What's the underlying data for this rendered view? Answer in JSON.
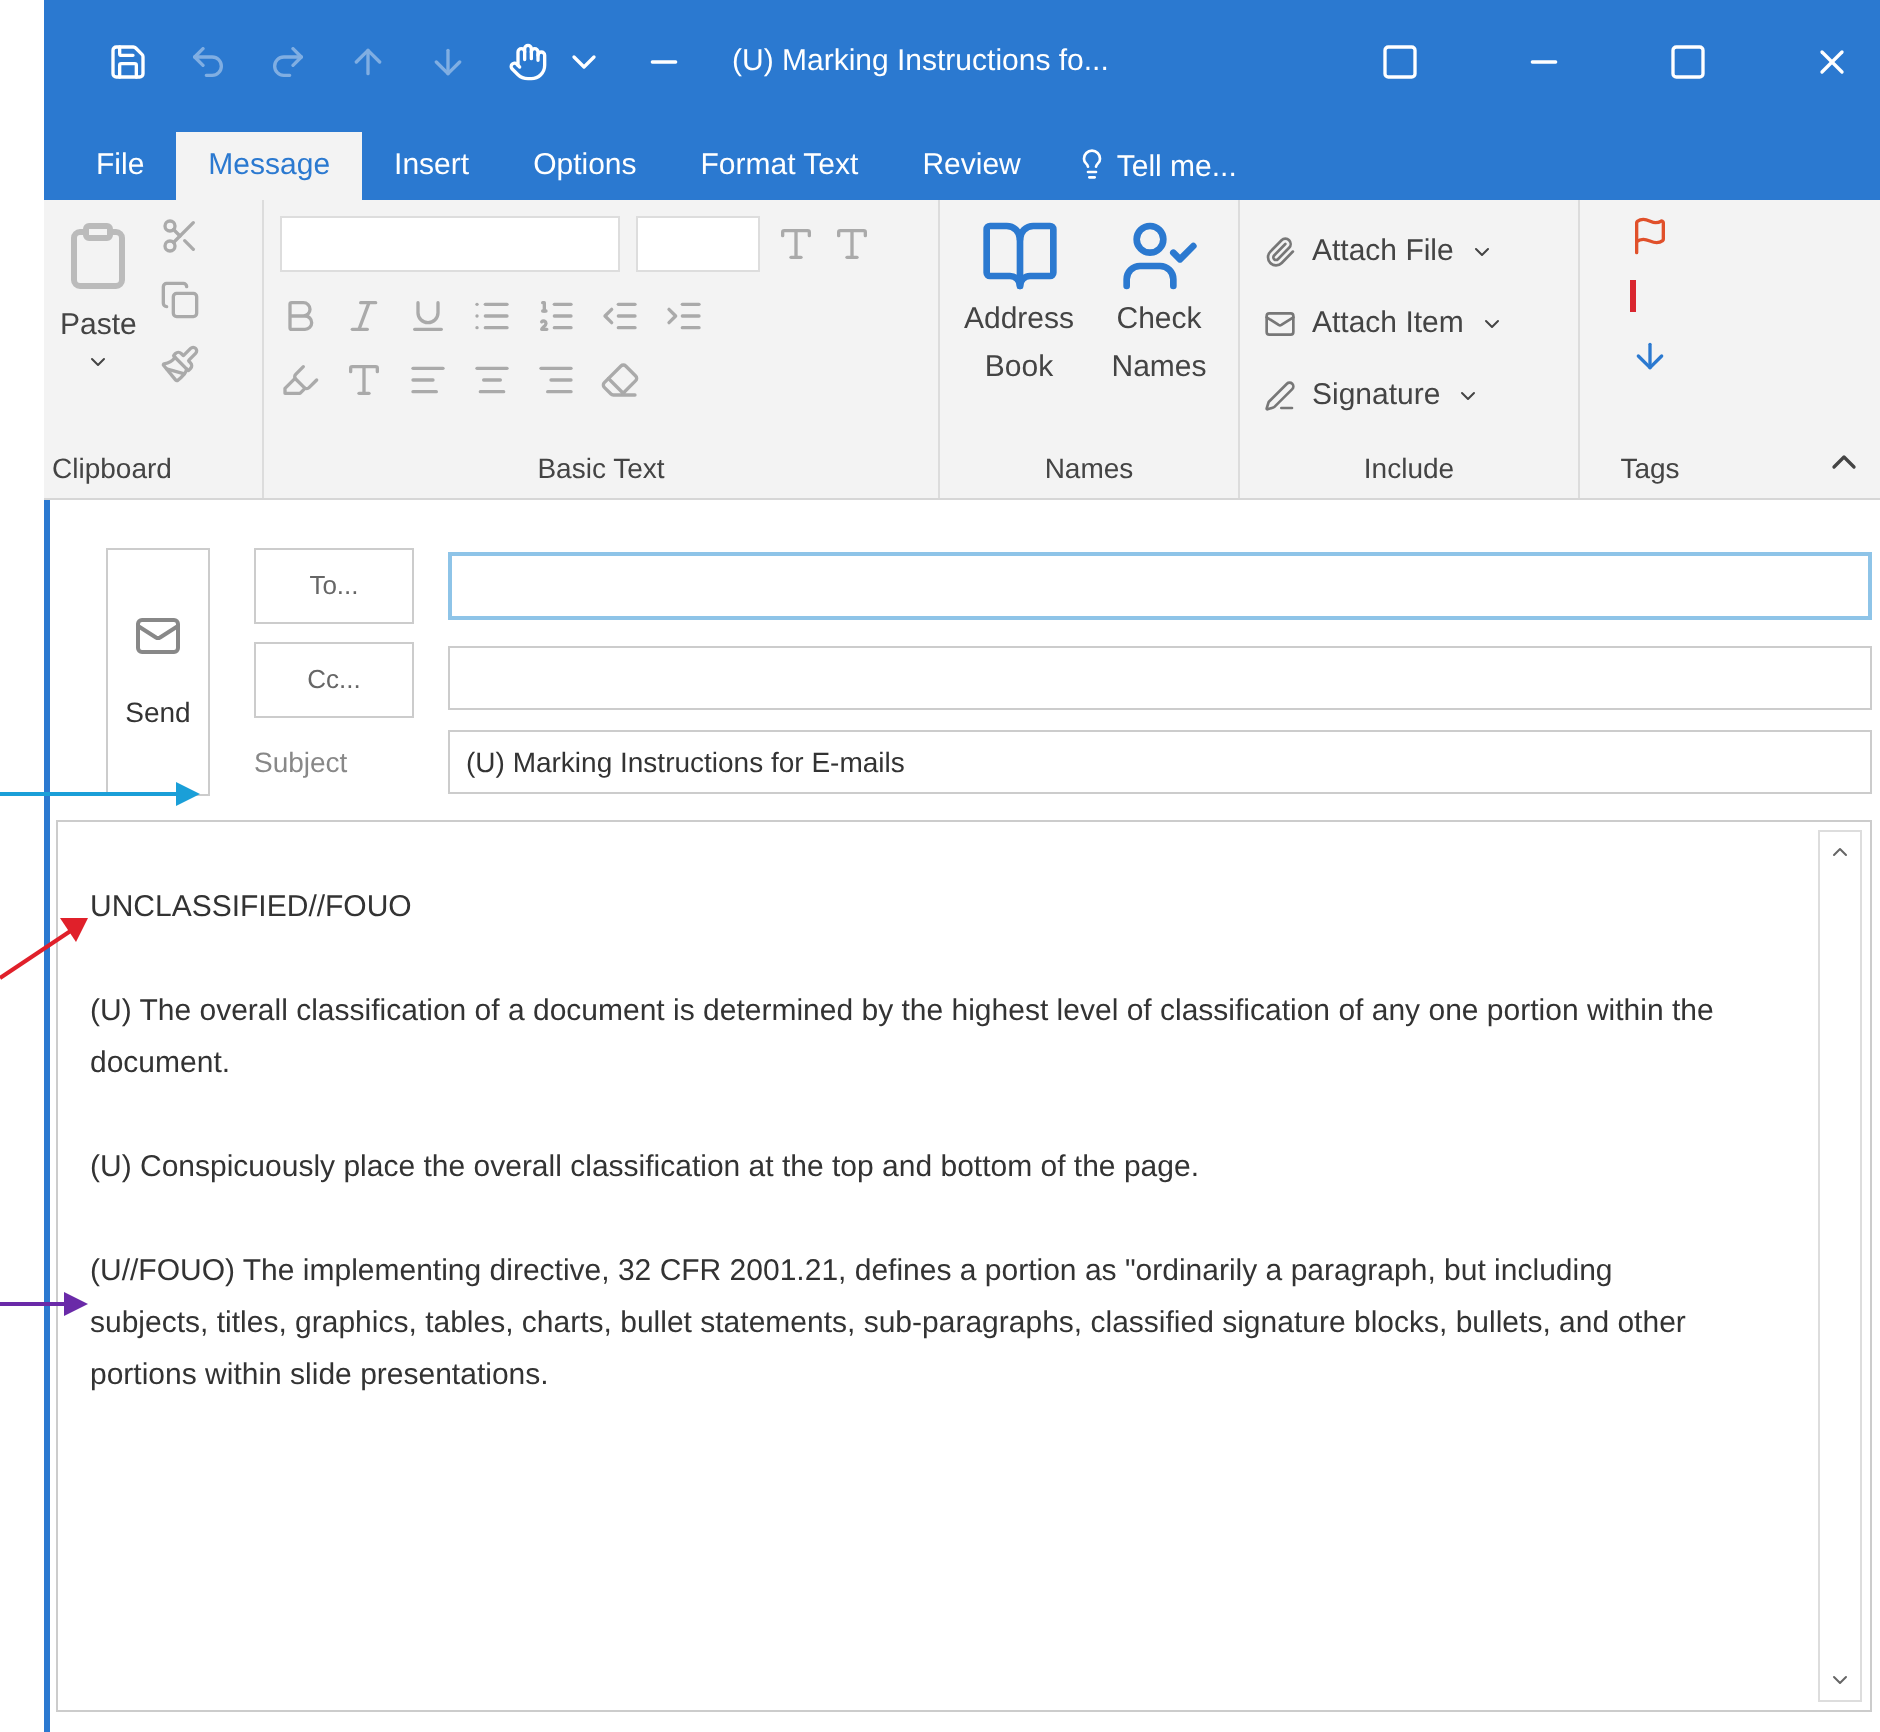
{
  "window": {
    "title": "(U) Marking Instructions fo..."
  },
  "tabs": [
    {
      "label": "File",
      "selected": false
    },
    {
      "label": "Message",
      "selected": true
    },
    {
      "label": "Insert",
      "selected": false
    },
    {
      "label": "Options",
      "selected": false
    },
    {
      "label": "Format Text",
      "selected": false
    },
    {
      "label": "Review",
      "selected": false
    }
  ],
  "tell_me": {
    "placeholder": "Tell me..."
  },
  "ribbon": {
    "paste": "Paste",
    "groups": [
      "Clipboard",
      "Basic Text",
      "Names",
      "Include",
      "Tags"
    ],
    "names_buttons": [
      {
        "label": "Address Book",
        "kind": "book"
      },
      {
        "label": "Check Names",
        "kind": "check"
      }
    ],
    "include_buttons": [
      {
        "label": "Attach File",
        "kind": "file"
      },
      {
        "label": "Attach Item",
        "kind": "item"
      },
      {
        "label": "Signature",
        "kind": "signature"
      }
    ]
  },
  "compose": {
    "send": "Send",
    "to": "To...",
    "cc": "Cc...",
    "subject_label": "Subject",
    "subject": "(U) Marking Instructions for E-mails",
    "body": [
      "UNCLASSIFIED//FOUO",
      "(U) The overall classification of a document is determined by the highest level of classification of any one portion within the document.",
      "(U) Conspicuously place the overall classification at the top and bottom of the page.",
      "(U//FOUO) The implementing directive, 32 CFR 2001.21, defines a portion as \"ordinarily a paragraph, but including subjects, titles, graphics, tables, charts, bullet statements, sub-paragraphs, classified signature blocks, bullets, and other portions within slide presentations."
    ]
  },
  "annotations": [
    {
      "kind": "subject",
      "color": "#1a9fd8"
    },
    {
      "kind": "heading",
      "color": "#e0202a"
    },
    {
      "kind": "paragraph",
      "color": "#6a2aa8"
    }
  ]
}
